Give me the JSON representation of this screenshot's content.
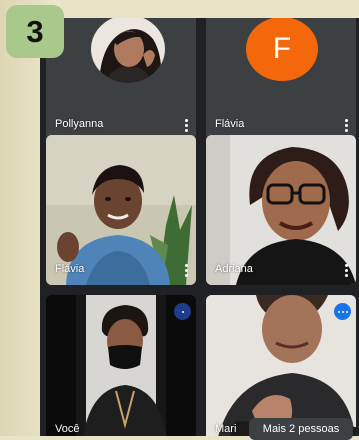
{
  "step_badge": "3",
  "participants": [
    {
      "name": "Pollyanna",
      "type": "photo-avatar"
    },
    {
      "name": "Flávia",
      "type": "letter-avatar",
      "initial": "F",
      "avatar_color": "#f4680b"
    },
    {
      "name": "Flávia",
      "type": "video"
    },
    {
      "name": "Adriana",
      "type": "video"
    },
    {
      "name": "Você",
      "type": "video"
    },
    {
      "name": "Mari",
      "type": "video",
      "speaking": true
    }
  ],
  "more_people_label": "Mais 2 pessoas",
  "colors": {
    "accent": "#1a73e8",
    "tile": "#3c4043",
    "background": "#202124"
  }
}
